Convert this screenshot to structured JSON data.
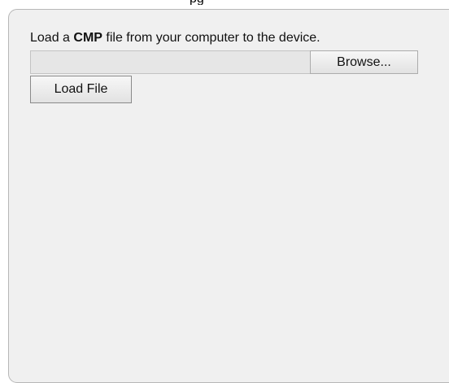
{
  "header": {
    "clipped_title_glyph": "pg"
  },
  "panel": {
    "instructions": {
      "prefix": "Load a ",
      "emphasis": "CMP",
      "suffix": " file from your computer to the device."
    },
    "file_input": {
      "value": "",
      "placeholder": ""
    },
    "browse_label": "Browse...",
    "load_label": "Load File"
  }
}
